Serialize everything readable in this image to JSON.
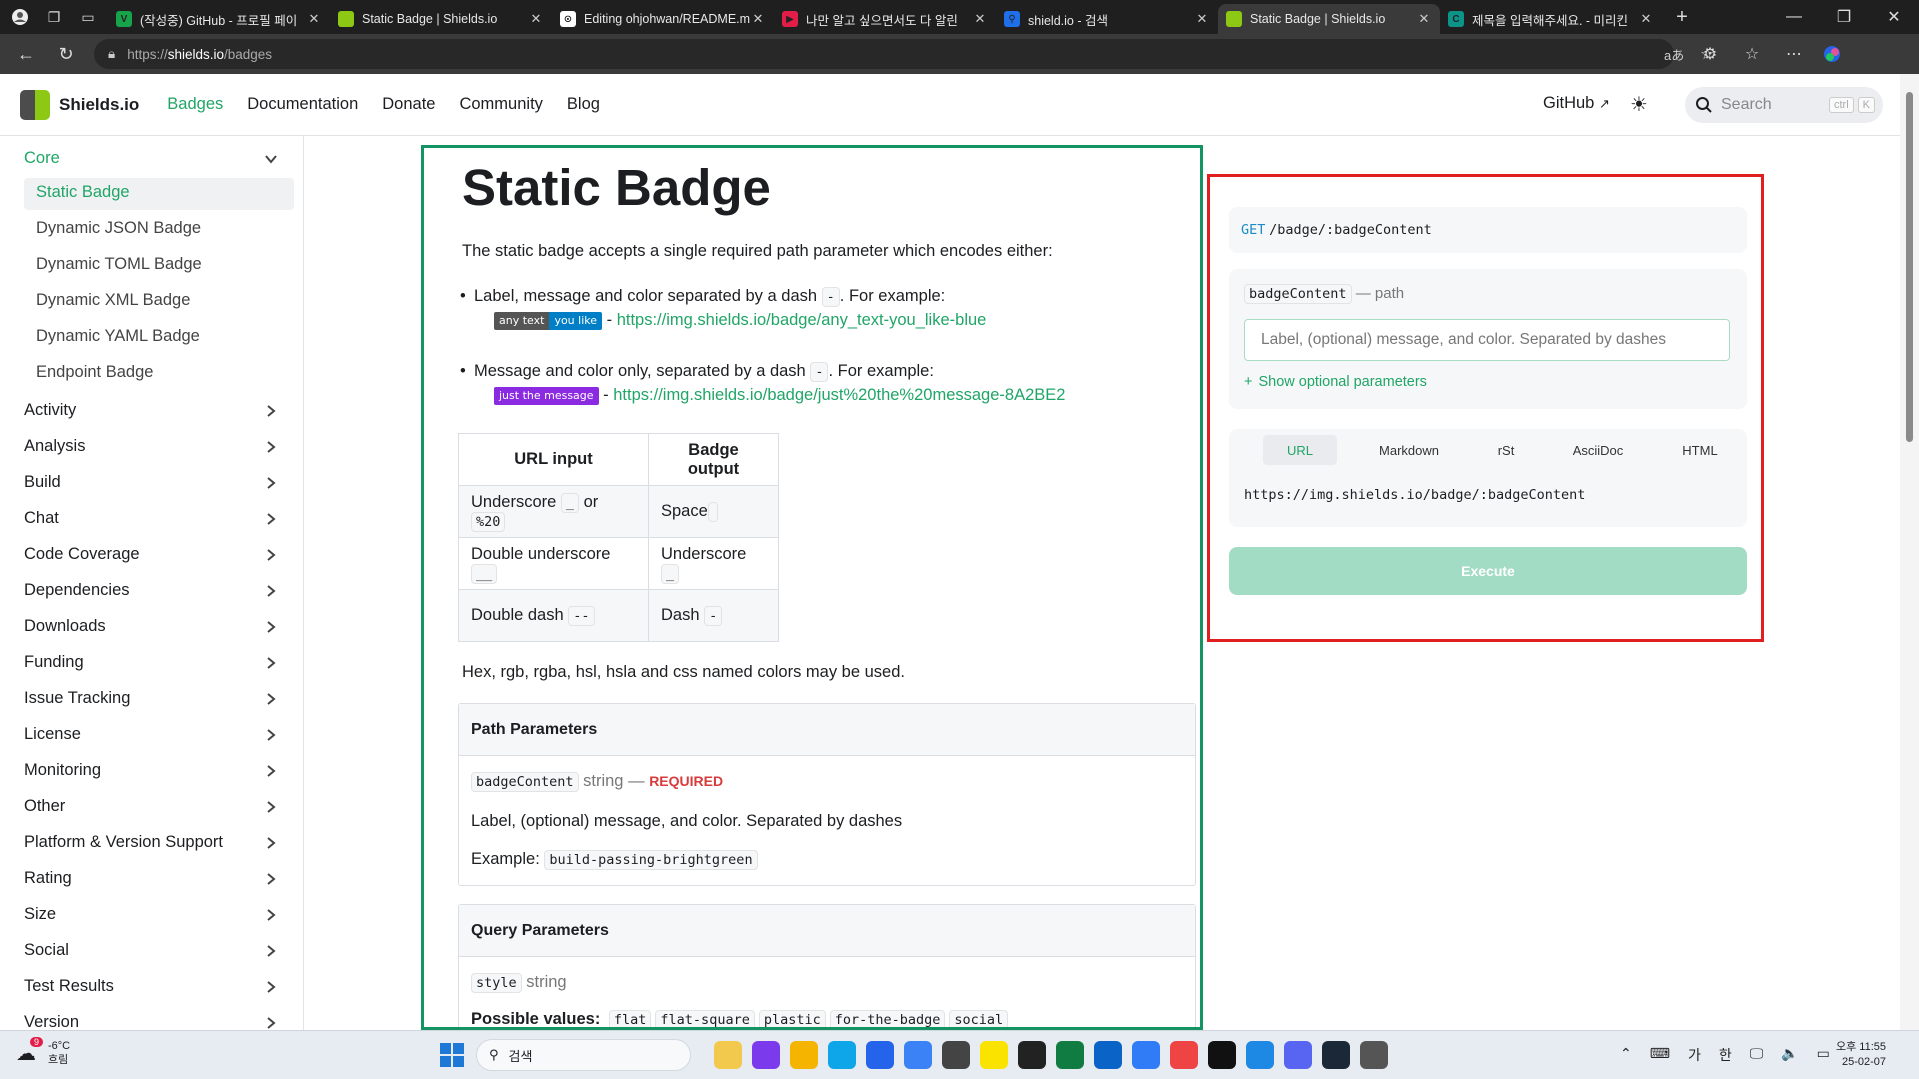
{
  "browser": {
    "tabs": [
      {
        "title": "(작성중) GitHub - 프로필 페이",
        "color": "#16a34a",
        "glyph": "V"
      },
      {
        "title": "Static Badge | Shields.io",
        "color": "#8dc814",
        "glyph": ""
      },
      {
        "title": "Editing ohjohwan/README.md",
        "color": "#ffffff",
        "glyph": "⊙"
      },
      {
        "title": "나만 알고 싶으면서도 다 알린",
        "color": "#e11d48",
        "glyph": "▶"
      },
      {
        "title": "shield.io - 검색",
        "color": "#1f6feb",
        "glyph": "⚲"
      },
      {
        "title": "Static Badge | Shields.io",
        "color": "#8dc814",
        "glyph": "",
        "active": true
      },
      {
        "title": "제목을 입력해주세요. - 미리킨",
        "color": "#0d9488",
        "glyph": "C"
      }
    ],
    "url_prefix": "https://",
    "url_host": "shields.io",
    "url_path": "/badges"
  },
  "header": {
    "logo": "Shields.io",
    "nav": [
      "Badges",
      "Documentation",
      "Donate",
      "Community",
      "Blog"
    ],
    "github": "GitHub",
    "search_placeholder": "Search",
    "kbd1": "ctrl",
    "kbd2": "K"
  },
  "sidebar": {
    "core": "Core",
    "sub_items": [
      "Static Badge",
      "Dynamic JSON Badge",
      "Dynamic TOML Badge",
      "Dynamic XML Badge",
      "Dynamic YAML Badge",
      "Endpoint Badge"
    ],
    "categories": [
      "Activity",
      "Analysis",
      "Build",
      "Chat",
      "Code Coverage",
      "Dependencies",
      "Downloads",
      "Funding",
      "Issue Tracking",
      "License",
      "Monitoring",
      "Other",
      "Platform & Version Support",
      "Rating",
      "Size",
      "Social",
      "Test Results",
      "Version"
    ]
  },
  "main": {
    "title": "Static Badge",
    "intro": "The static badge accepts a single required path parameter which encodes either:",
    "bullet1_pre": "Label, message and color separated by a dash",
    "bullet1_code": "-",
    "bullet1_post": ". For example:",
    "badge1_label": "any text",
    "badge1_msg": "you like",
    "badge1_color": "#007ec6",
    "link1": "https://img.shields.io/badge/any_text-you_like-blue",
    "bullet2_pre": "Message and color only, separated by a dash",
    "bullet2_code": "-",
    "bullet2_post": ". For example:",
    "badge2_msg": "just the message",
    "badge2_color": "#8a2be2",
    "link2": "https://img.shields.io/badge/just%20the%20message-8A2BE2",
    "dash_sep": "-",
    "table": {
      "headers": [
        "URL input",
        "Badge output"
      ],
      "rows": [
        {
          "in": "Underscore",
          "in_code": "_",
          "in_or": "or",
          "in_code2": "%20",
          "out": "Space",
          "out_code": " "
        },
        {
          "in": "Double underscore",
          "in_code": "__",
          "out": "Underscore",
          "out_code": "_"
        },
        {
          "in": "Double dash",
          "in_code": "--",
          "out": "Dash",
          "out_code": "-"
        }
      ]
    },
    "colors_note": "Hex, rgb, rgba, hsl, hsla and css named colors may be used.",
    "path_params": {
      "title": "Path Parameters",
      "name": "badgeContent",
      "type": "string",
      "sep": "—",
      "required": "REQUIRED",
      "desc": "Label, (optional) message, and color. Separated by dashes",
      "example_label": "Example:",
      "example": "build-passing-brightgreen"
    },
    "query_params": {
      "title": "Query Parameters",
      "name": "style",
      "type": "string",
      "possible_label": "Possible values:",
      "values": [
        "flat",
        "flat-square",
        "plastic",
        "for-the-badge",
        "social"
      ]
    }
  },
  "try": {
    "method": "GET",
    "path": "/badge/:badgeContent",
    "param_name": "badgeContent",
    "param_kind": "— path",
    "input_placeholder": "Label, (optional) message, and color. Separated by dashes",
    "optional_label": "Show optional parameters",
    "plus": "+",
    "tabs": [
      "URL",
      "Markdown",
      "rSt",
      "AsciiDoc",
      "HTML"
    ],
    "url_out": "https://img.shields.io/badge/:badgeContent",
    "execute": "Execute"
  },
  "taskbar": {
    "weather_temp": "-6°C",
    "weather_desc": "흐림",
    "weather_badge": "9",
    "search": "검색",
    "lang1": "가",
    "lang2": "한",
    "time": "오후 11:55",
    "date": "25-02-07"
  }
}
